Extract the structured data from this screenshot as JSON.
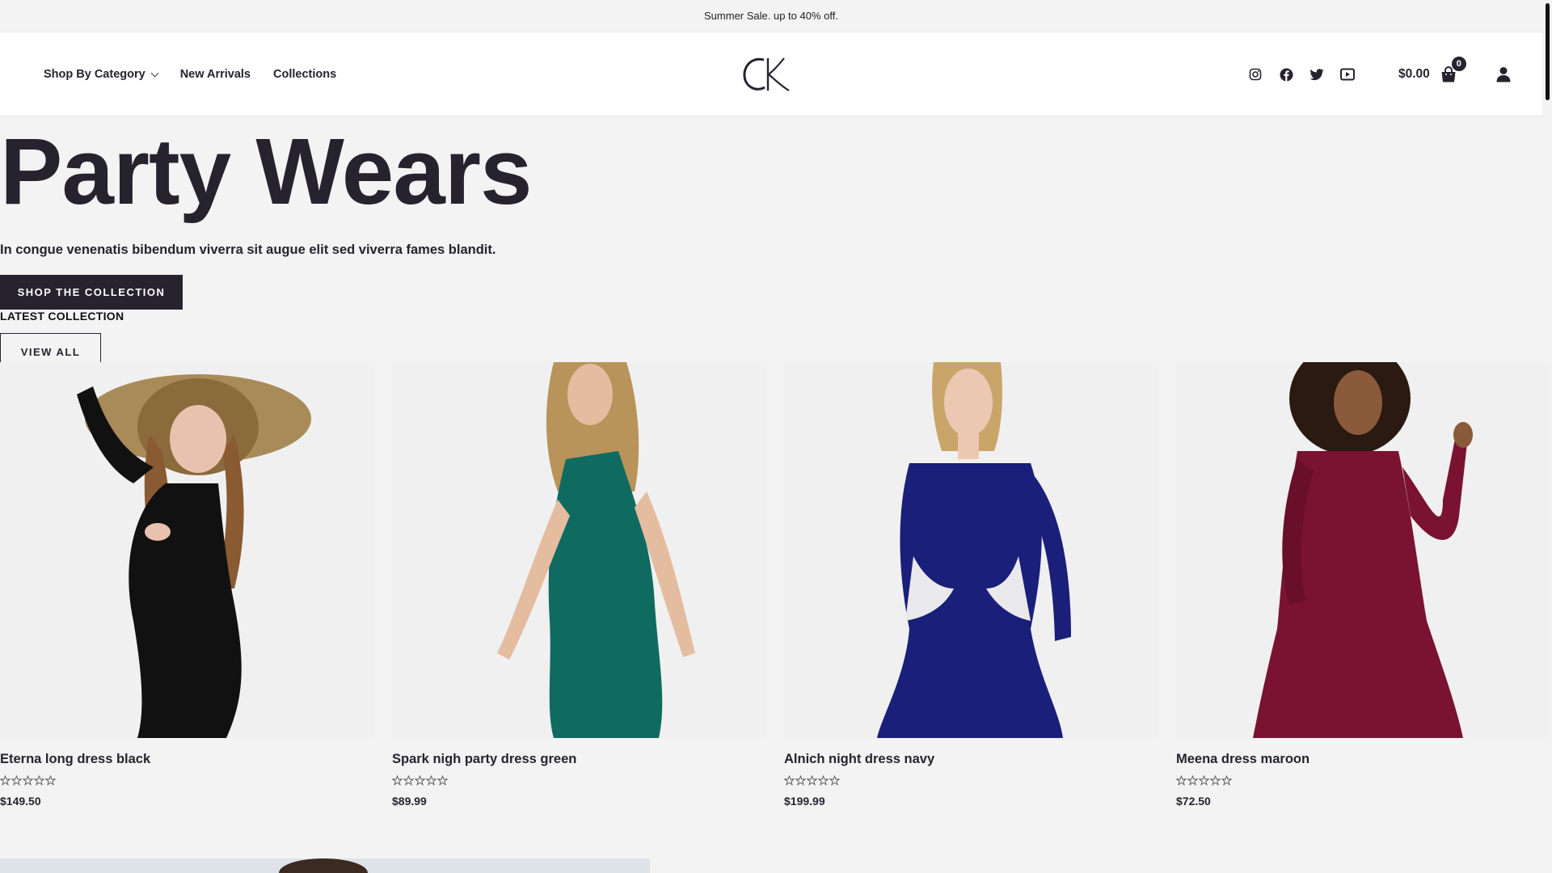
{
  "announcement": "Summer Sale. up to 40% off.",
  "nav": {
    "items": [
      {
        "label": "Shop By Category",
        "has_dropdown": true
      },
      {
        "label": "New Arrivals",
        "has_dropdown": false
      },
      {
        "label": "Collections",
        "has_dropdown": false
      }
    ]
  },
  "logo": {
    "text": "CK"
  },
  "socials": [
    "instagram-icon",
    "facebook-icon",
    "twitter-icon",
    "youtube-icon"
  ],
  "cart": {
    "total": "$0.00",
    "count": "0"
  },
  "account_icon": "user-icon",
  "hero": {
    "title": "Party Wears",
    "subtitle": "In congue venenatis bibendum viverra sit augue elit sed viverra fames blandit.",
    "cta": "SHOP THE COLLECTION"
  },
  "latest": {
    "label": "LATEST COLLECTION",
    "view_all": "VIEW ALL"
  },
  "products": [
    {
      "name": "Eterna long dress black",
      "price": "$149.50",
      "rating": 0,
      "dress_color": "#111111"
    },
    {
      "name": "Spark nigh party dress green",
      "price": "$89.99",
      "rating": 0,
      "dress_color": "#0f6b60"
    },
    {
      "name": "Alnich night dress navy",
      "price": "$199.99",
      "rating": 0,
      "dress_color": "#1a1f7a"
    },
    {
      "name": "Meena dress maroon",
      "price": "$72.50",
      "rating": 0,
      "dress_color": "#7a1232"
    }
  ],
  "colors": {
    "primary": "#26232f",
    "background": "#f3f3f3"
  }
}
